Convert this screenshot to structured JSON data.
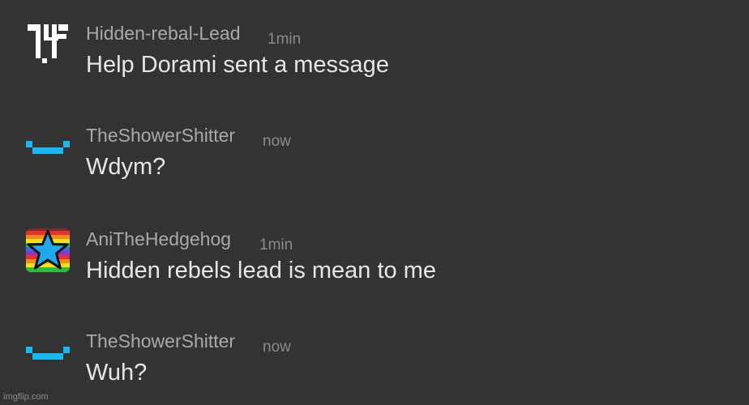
{
  "messages": [
    {
      "username": "Hidden-rebal-Lead",
      "timestamp": "1min",
      "text": "Help Dorami sent a message",
      "avatar_icon": "white-pixel-logo-icon"
    },
    {
      "username": "TheShowerShitter",
      "timestamp": "now",
      "text": "Wdym?",
      "avatar_icon": "cyan-pixel-smile-icon"
    },
    {
      "username": "AniTheHedgehog",
      "timestamp": "1min",
      "text": "Hidden rebels lead is mean to me",
      "avatar_icon": "rainbow-star-icon"
    },
    {
      "username": "TheShowerShitter",
      "timestamp": "now",
      "text": "Wuh?",
      "avatar_icon": "cyan-pixel-smile-icon"
    }
  ],
  "watermark": "imgflip.com",
  "colors": {
    "background": "#333333",
    "username": "#a9a9a9",
    "timestamp": "#8a8a8a",
    "message_text": "#e6e6e6",
    "smile_cyan": "#19b8f0"
  }
}
